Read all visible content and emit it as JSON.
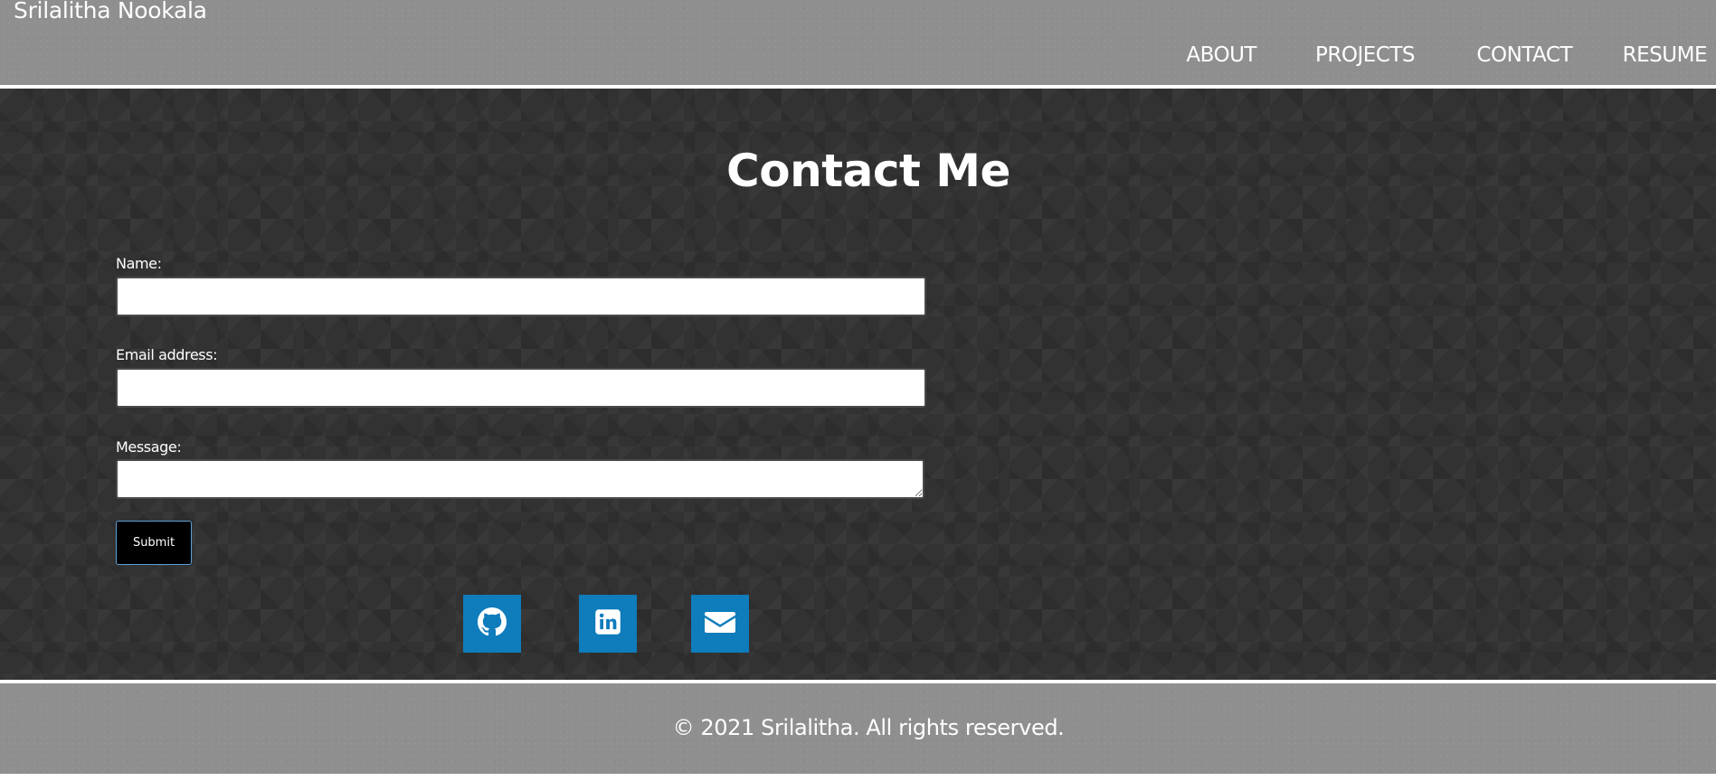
{
  "header": {
    "brand": "Srilalitha Nookala",
    "nav": [
      {
        "label": "ABOUT"
      },
      {
        "label": "PROJECTS"
      },
      {
        "label": "CONTACT"
      },
      {
        "label": "RESUME"
      }
    ]
  },
  "contact": {
    "title": "Contact Me",
    "fields": {
      "name_label": "Name:",
      "name_value": "",
      "email_label": "Email address:",
      "email_value": "",
      "message_label": "Message:",
      "message_value": ""
    },
    "submit_label": "Submit",
    "social": [
      {
        "icon": "github-icon"
      },
      {
        "icon": "linkedin-icon"
      },
      {
        "icon": "envelope-icon"
      }
    ]
  },
  "footer": {
    "text": "© 2021 Srilalitha. All rights reserved."
  },
  "colors": {
    "header_bg": "#8f8f8f",
    "main_bg": "#323232",
    "social_bg": "#0f7cbc",
    "submit_bg": "#000000"
  }
}
